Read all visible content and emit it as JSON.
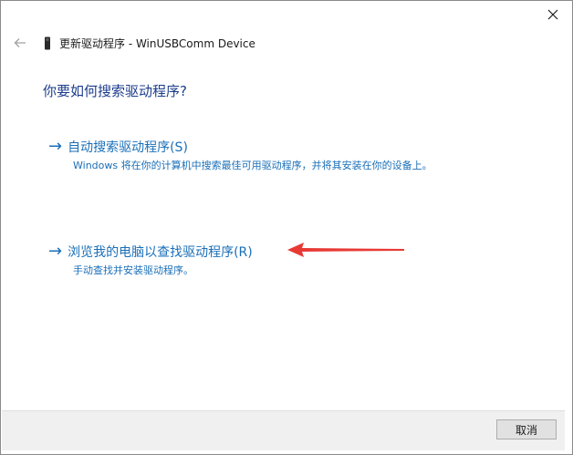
{
  "window": {
    "title": "更新驱动程序 - WinUSBComm Device",
    "close_icon": "close-icon",
    "back_icon": "back-arrow-icon",
    "device_icon": "usb-device-icon"
  },
  "main": {
    "heading": "你要如何搜索驱动程序?",
    "options": [
      {
        "arrow": "→",
        "title": "自动搜索驱动程序(S)",
        "description": "Windows 将在你的计算机中搜索最佳可用驱动程序，并将其安装在你的设备上。"
      },
      {
        "arrow": "→",
        "title": "浏览我的电脑以查找驱动程序(R)",
        "description": "手动查找并安装驱动程序。"
      }
    ],
    "annotation_color": "#e83a35",
    "link_color": "#1a6fb8",
    "heading_color": "#1c3c8c"
  },
  "footer": {
    "cancel_label": "取消"
  }
}
